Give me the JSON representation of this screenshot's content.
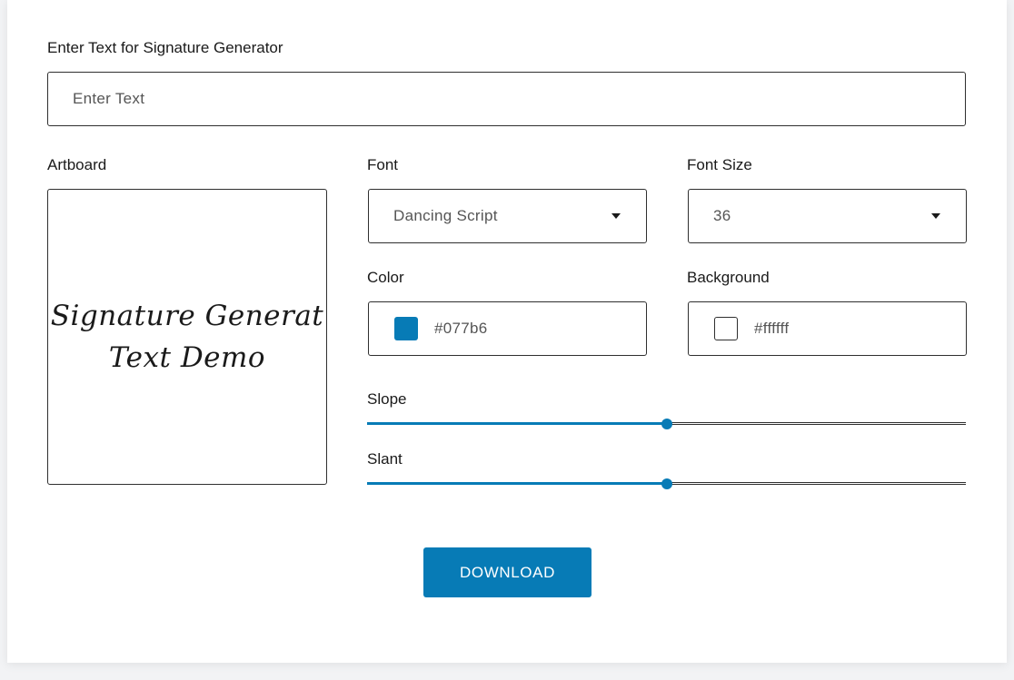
{
  "text_input": {
    "label": "Enter Text for Signature Generator",
    "placeholder": "Enter  Text",
    "value": ""
  },
  "artboard": {
    "label": "Artboard",
    "lines": [
      "Signature Generat",
      "Text Demo"
    ]
  },
  "font": {
    "label": "Font",
    "value": "Dancing Script"
  },
  "font_size": {
    "label": "Font Size",
    "value": "36"
  },
  "color": {
    "label": "Color",
    "value": "#077b6",
    "swatch": "#077bb6"
  },
  "background": {
    "label": "Background",
    "value": "#ffffff",
    "swatch": "#ffffff"
  },
  "slope": {
    "label": "Slope",
    "value_fraction": 0.5
  },
  "slant": {
    "label": "Slant",
    "value_fraction": 0.5
  },
  "download": {
    "label": "DOWNLOAD"
  },
  "colors": {
    "accent": "#077bb6",
    "border": "#2f2f2f"
  }
}
